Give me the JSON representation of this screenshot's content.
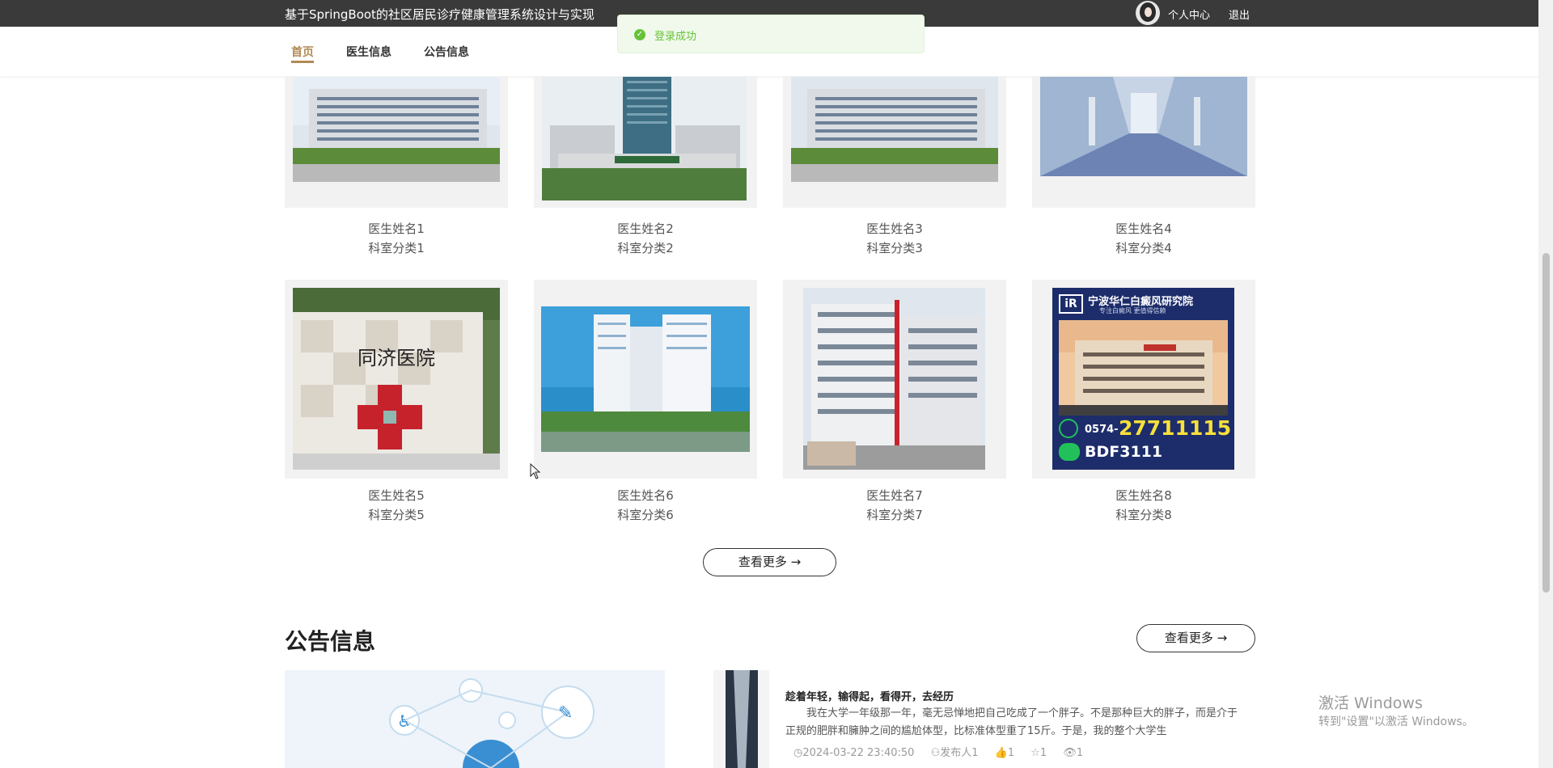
{
  "header": {
    "site_title": "基于SpringBoot的社区居民诊疗健康管理系统设计与实现",
    "profile_link": "个人中心",
    "logout_link": "退出"
  },
  "nav": {
    "items": [
      {
        "label": "首页",
        "active": true
      },
      {
        "label": "医生信息",
        "active": false
      },
      {
        "label": "公告信息",
        "active": false
      }
    ]
  },
  "toast": {
    "message": "登录成功",
    "icon": "success-check-icon"
  },
  "doctors": [
    {
      "name": "医生姓名1",
      "department": "科室分类1"
    },
    {
      "name": "医生姓名2",
      "department": "科室分类2"
    },
    {
      "name": "医生姓名3",
      "department": "科室分类3"
    },
    {
      "name": "医生姓名4",
      "department": "科室分类4"
    },
    {
      "name": "医生姓名5",
      "department": "科室分类5"
    },
    {
      "name": "医生姓名6",
      "department": "科室分类6"
    },
    {
      "name": "医生姓名7",
      "department": "科室分类7"
    },
    {
      "name": "医生姓名8",
      "department": "科室分类8"
    }
  ],
  "hospital_ad": {
    "brand": "宁波华仁白癜风研究院",
    "slogan": "专注白癜风 更值得信赖",
    "phone_prefix": "0574-",
    "phone": "27711115",
    "wechat": "BDF3111"
  },
  "doctor_section": {
    "more_label": "查看更多 →"
  },
  "notice_section": {
    "title": "公告信息",
    "more_label": "查看更多 →",
    "notice": {
      "title": "趁着年轻，输得起，看得开，去经历",
      "body": "我在大学一年级那一年，毫无忌惮地把自己吃成了一个胖子。不是那种巨大的胖子，而是介于正规的肥胖和臃肿之间的尴尬体型，比标准体型重了15斤。于是，我的整个大学生",
      "date": "2024-03-22 23:40:50",
      "publisher": "发布人1",
      "likes": "1",
      "favorites": "1",
      "views": "1"
    }
  },
  "watermark": {
    "line1": "激活 Windows",
    "line2": "转到\"设置\"以激活 Windows。"
  }
}
